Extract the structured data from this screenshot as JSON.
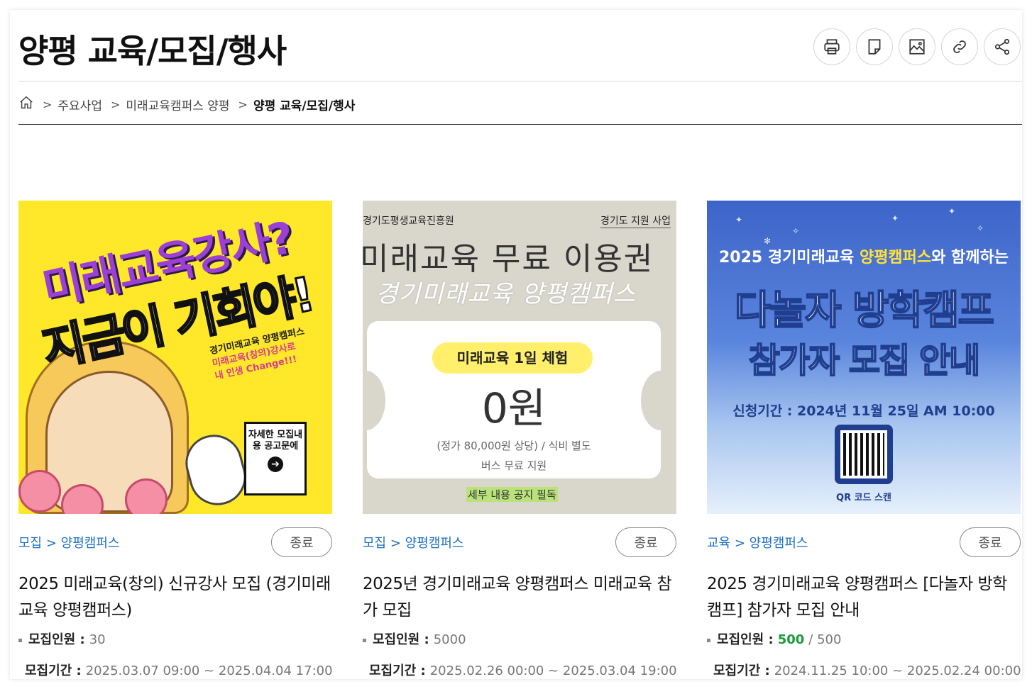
{
  "page": {
    "title": "양평 교육/모집/행사"
  },
  "toolbar": {
    "buttons": [
      {
        "name": "print",
        "icon": "printer-icon"
      },
      {
        "name": "memo",
        "icon": "note-icon"
      },
      {
        "name": "image",
        "icon": "image-icon"
      },
      {
        "name": "link",
        "icon": "link-icon"
      },
      {
        "name": "share",
        "icon": "share-icon"
      }
    ]
  },
  "breadcrumb": {
    "home_icon": "home-icon",
    "items": [
      "주요사업",
      "미래교육캠퍼스 양평",
      "양평 교육/모집/행사"
    ]
  },
  "cards": [
    {
      "category": "모집 > 양평캠퍼스",
      "status": "종료",
      "title": "2025 미래교육(창의) 신규강사 모집 (경기미래교육 양평캠퍼스)",
      "recruit_label": "모집인원 :",
      "recruit_value": "30",
      "period_label": "모집기간 :",
      "period_value": "2025.03.07 09:00 ~ 2025.04.04 17:00",
      "thumb": {
        "headline1": "미래교육강사?",
        "headline2": "지금이 기회야!",
        "sub1": "경기미래교육 양평캠퍼스",
        "sub2": "미래교육(창의)강사로",
        "sub3": "내 인생 Change!!!",
        "box": "자세한 모집내용 공고문에"
      }
    },
    {
      "category": "모집 > 양평캠퍼스",
      "status": "종료",
      "title": "2025년 경기미래교육 양평캠퍼스 미래교육 참가 모집",
      "recruit_label": "모집인원 :",
      "recruit_value": "5000",
      "period_label": "모집기간 :",
      "period_value": "2025.02.26 00:00 ~ 2025.03.04 19:00",
      "thumb": {
        "org": "경기도평생교육진흥원",
        "sponsor": "경기도 지원 사업",
        "big": "미래교육 무료 이용권",
        "campus": "경기미래교육 양평캠퍼스",
        "pill": "미래교육 1일 체험",
        "price": "0원",
        "fine1": "(정가 80,000원 상당) / 식비 별도",
        "fine2": "버스 무료 지원",
        "note": "세부 내용 공지 필독"
      }
    },
    {
      "category": "교육 > 양평캠퍼스",
      "status": "종료",
      "title": "2025 경기미래교육 양평캠퍼스 [다놀자 방학캠프] 참가자 모집 안내",
      "recruit_label": "모집인원 :",
      "recruit_current": "500",
      "recruit_value": "/ 500",
      "period_label": "모집기간 :",
      "period_value": "2024.11.25 10:00 ~ 2025.02.24 00:00",
      "thumb": {
        "line1a": "2025 경기미래교육 ",
        "line1b": "양평캠퍼스",
        "line1c": "와 함께하는",
        "h1": "다놀자 방학캠프",
        "h2": "참가자 모집 안내",
        "period": "신청기간 : 2024년 11월 25일 AM 10:00",
        "qr_label": "QR 코드 스캔"
      }
    }
  ],
  "colors": {
    "category": "#1a6fc4",
    "recruit_current": "#1c9a3c",
    "thumb1_bg": "#ffe82a",
    "thumb2_bg": "#d9d7cc",
    "thumb3_bg": "#3d64c9"
  }
}
